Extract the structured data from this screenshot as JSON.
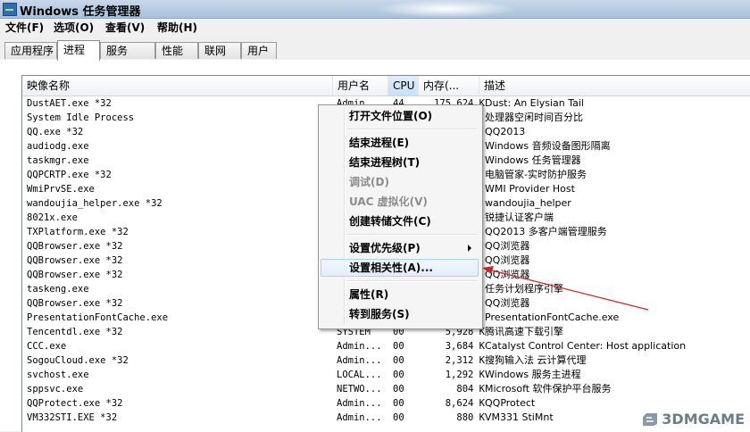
{
  "window": {
    "title": "Windows 任务管理器"
  },
  "menu": [
    "文件(F)",
    "选项(O)",
    "查看(V)",
    "帮助(H)"
  ],
  "tabs": [
    "应用程序",
    "进程",
    "服务",
    "性能",
    "联网",
    "用户"
  ],
  "active_tab": 1,
  "columns": {
    "name": "映像名称",
    "user": "用户名",
    "cpu": "CPU",
    "mem": "内存(...",
    "desc": "描述"
  },
  "rows": [
    {
      "name": "DustAET.exe *32",
      "user": "Admin...",
      "cpu": "44",
      "mem": "175,624 K",
      "desc": "Dust: An Elysian Tail"
    },
    {
      "name": "System Idle Process",
      "user": "",
      "cpu": "",
      "mem": "",
      "desc": "处理器空闲时间百分比"
    },
    {
      "name": "QQ.exe *32",
      "user": "",
      "cpu": "",
      "mem": "",
      "desc": "QQ2013"
    },
    {
      "name": "audiodg.exe",
      "user": "",
      "cpu": "",
      "mem": "",
      "desc": "Windows 音频设备图形隔离"
    },
    {
      "name": "taskmgr.exe",
      "user": "",
      "cpu": "",
      "mem": "",
      "desc": "Windows 任务管理器"
    },
    {
      "name": "QQPCRTP.exe *32",
      "user": "",
      "cpu": "",
      "mem": "",
      "desc": "电脑管家-实时防护服务"
    },
    {
      "name": "WmiPrvSE.exe",
      "user": "",
      "cpu": "",
      "mem": "",
      "desc": "WMI Provider Host"
    },
    {
      "name": "wandoujia_helper.exe *32",
      "user": "",
      "cpu": "",
      "mem": "",
      "desc": "wandoujia_helper"
    },
    {
      "name": "8021x.exe",
      "user": "",
      "cpu": "",
      "mem": "",
      "desc": "锐捷认证客户端"
    },
    {
      "name": "TXPlatform.exe *32",
      "user": "",
      "cpu": "",
      "mem": "",
      "desc": "QQ2013 多客户端管理服务"
    },
    {
      "name": "QQBrowser.exe *32",
      "user": "",
      "cpu": "",
      "mem": "",
      "desc": "QQ浏览器"
    },
    {
      "name": "QQBrowser.exe *32",
      "user": "",
      "cpu": "",
      "mem": "",
      "desc": "QQ浏览器"
    },
    {
      "name": "QQBrowser.exe *32",
      "user": "",
      "cpu": "",
      "mem": "",
      "desc": "QQ浏览器"
    },
    {
      "name": "taskeng.exe",
      "user": "",
      "cpu": "",
      "mem": "",
      "desc": "任务计划程序引擎"
    },
    {
      "name": "QQBrowser.exe *32",
      "user": "",
      "cpu": "",
      "mem": "",
      "desc": "QQ浏览器"
    },
    {
      "name": "PresentationFontCache.exe",
      "user": "",
      "cpu": "",
      "mem": "",
      "desc": "PresentationFontCache.exe"
    },
    {
      "name": "Tencentdl.exe *32",
      "user": "SYSTEM",
      "cpu": "00",
      "mem": "5,928 K",
      "desc": "腾讯高速下载引擎"
    },
    {
      "name": "CCC.exe",
      "user": "Admin...",
      "cpu": "00",
      "mem": "3,684 K",
      "desc": "Catalyst Control Center: Host application"
    },
    {
      "name": "SogouCloud.exe *32",
      "user": "Admin...",
      "cpu": "00",
      "mem": "2,312 K",
      "desc": "搜狗输入法 云计算代理"
    },
    {
      "name": "svchost.exe",
      "user": "LOCAL...",
      "cpu": "00",
      "mem": "1,292 K",
      "desc": "Windows 服务主进程"
    },
    {
      "name": "sppsvc.exe",
      "user": "NETWO...",
      "cpu": "00",
      "mem": "804 K",
      "desc": "Microsoft 软件保护平台服务"
    },
    {
      "name": "QQProtect.exe *32",
      "user": "Admin...",
      "cpu": "00",
      "mem": "8,624 K",
      "desc": "QQProtect"
    },
    {
      "name": "VM332STI.EXE *32",
      "user": "Admin...",
      "cpu": "00",
      "mem": "880 K",
      "desc": "VM331 StiMnt"
    }
  ],
  "context_menu": {
    "items": [
      {
        "label": "打开文件位置(O)",
        "disabled": false
      },
      {
        "label": "结束进程(E)",
        "disabled": false
      },
      {
        "label": "结束进程树(T)",
        "disabled": false
      },
      {
        "label": "调试(D)",
        "disabled": true
      },
      {
        "label": "UAC 虚拟化(V)",
        "disabled": true
      },
      {
        "label": "创建转储文件(C)",
        "disabled": false
      },
      {
        "label": "设置优先级(P)",
        "disabled": false,
        "submenu": true
      },
      {
        "label": "设置相关性(A)...",
        "disabled": false,
        "highlighted": true
      },
      {
        "label": "属性(R)",
        "disabled": false
      },
      {
        "label": "转到服务(S)",
        "disabled": false
      }
    ]
  },
  "watermark": {
    "text": "3DMGAME"
  },
  "colors": {
    "annotation": "#c62828",
    "highlight_border": "#a8d1f5",
    "title_gradient": "#a9c1dc"
  }
}
